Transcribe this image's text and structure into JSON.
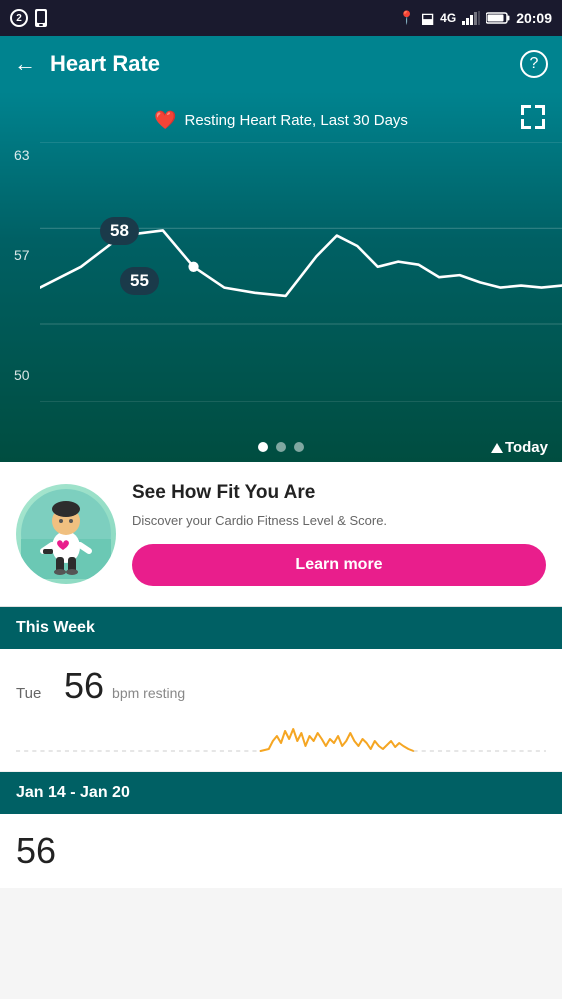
{
  "status_bar": {
    "time": "20:09",
    "left_icons": [
      "circle-2",
      "phone"
    ],
    "right_icons": [
      "location",
      "bluetooth",
      "4g",
      "signal",
      "battery"
    ]
  },
  "header": {
    "title": "Heart Rate",
    "back_label": "←",
    "help_label": "?"
  },
  "chart": {
    "resting_label": "Resting Heart Rate, Last 30 Days",
    "y_axis": {
      "top": "63",
      "mid": "57",
      "bottom": "50"
    },
    "callout_high": "58",
    "callout_low": "55",
    "dots": [
      "inactive",
      "active",
      "inactive"
    ],
    "today_label": "Today"
  },
  "cardio_card": {
    "title": "See How Fit You Are",
    "description": "Discover your Cardio Fitness Level & Score.",
    "button_label": "Learn more",
    "avatar_emoji": "🧍"
  },
  "this_week": {
    "section_label": "This Week",
    "day": "Tue",
    "bpm_value": "56",
    "bpm_unit": "bpm resting"
  },
  "date_range": {
    "section_label": "Jan 14 - Jan 20",
    "partial_bpm": "56"
  }
}
